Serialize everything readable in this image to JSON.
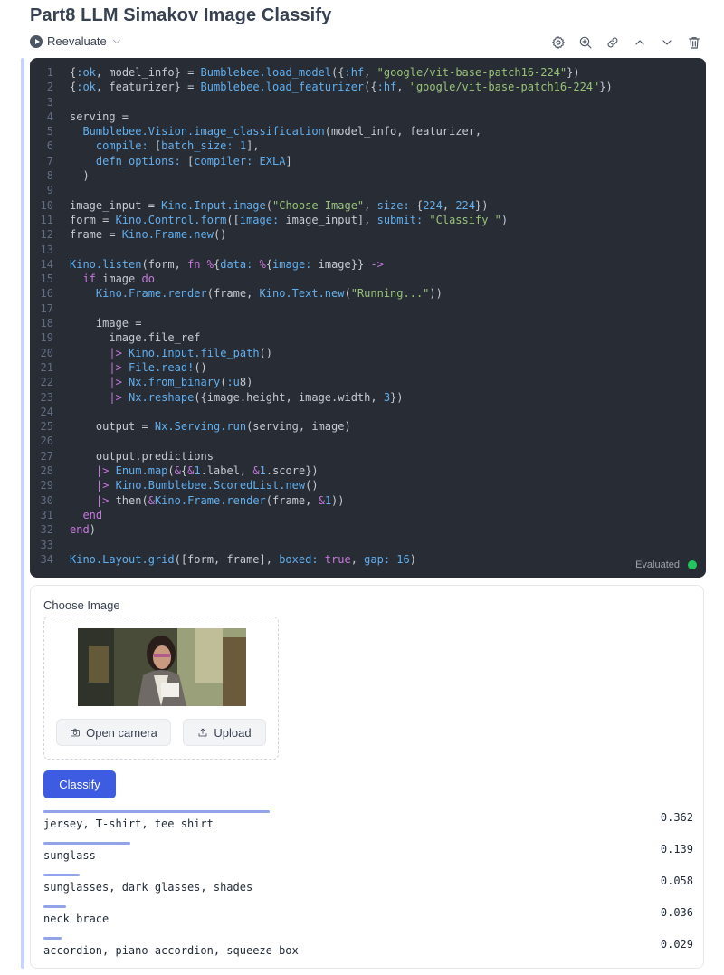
{
  "notebook": {
    "title": "Part8 LLM Simakov Image Classify"
  },
  "toolbar": {
    "reevaluate_label": "Reevaluate",
    "actions": [
      "gear-icon",
      "zoom-icon",
      "link-icon",
      "chevron-up-icon",
      "chevron-down-icon",
      "trash-icon"
    ]
  },
  "code": {
    "lines": [
      "{:ok, model_info} = Bumblebee.load_model({:hf, \"google/vit-base-patch16-224\"})",
      "{:ok, featurizer} = Bumblebee.load_featurizer({:hf, \"google/vit-base-patch16-224\"})",
      "",
      "serving =",
      "  Bumblebee.Vision.image_classification(model_info, featurizer,",
      "    compile: [batch_size: 1],",
      "    defn_options: [compiler: EXLA]",
      "  )",
      "",
      "image_input = Kino.Input.image(\"Choose Image\", size: {224, 224})",
      "form = Kino.Control.form([image: image_input], submit: \"Classify \")",
      "frame = Kino.Frame.new()",
      "",
      "Kino.listen(form, fn %{data: %{image: image}} ->",
      "  if image do",
      "    Kino.Frame.render(frame, Kino.Text.new(\"Running...\"))",
      "",
      "    image =",
      "      image.file_ref",
      "      |> Kino.Input.file_path()",
      "      |> File.read!()",
      "      |> Nx.from_binary(:u8)",
      "      |> Nx.reshape({image.height, image.width, 3})",
      "",
      "    output = Nx.Serving.run(serving, image)",
      "",
      "    output.predictions",
      "    |> Enum.map(&{&1.label, &1.score})",
      "    |> Kino.Bumblebee.ScoredList.new()",
      "    |> then(&Kino.Frame.render(frame, &1))",
      "  end",
      "end)",
      "",
      "Kino.Layout.grid([form, frame], boxed: true, gap: 16)"
    ],
    "status": "Evaluated",
    "status_color": "#22c55e"
  },
  "form": {
    "input_label": "Choose Image",
    "open_camera_label": "Open camera",
    "upload_label": "Upload",
    "submit_label": "Classify"
  },
  "predictions": [
    {
      "label": "jersey, T-shirt, tee shirt",
      "score": "0.362",
      "value": 0.362
    },
    {
      "label": "sunglass",
      "score": "0.139",
      "value": 0.139
    },
    {
      "label": "sunglasses, dark glasses, shades",
      "score": "0.058",
      "value": 0.058
    },
    {
      "label": "neck brace",
      "score": "0.036",
      "value": 0.036
    },
    {
      "label": "accordion, piano accordion, squeeze box",
      "score": "0.029",
      "value": 0.029
    }
  ],
  "colors": {
    "accent": "#3e5ce1",
    "score_bar": "#91a4ea",
    "editor_bg": "#282c34"
  }
}
